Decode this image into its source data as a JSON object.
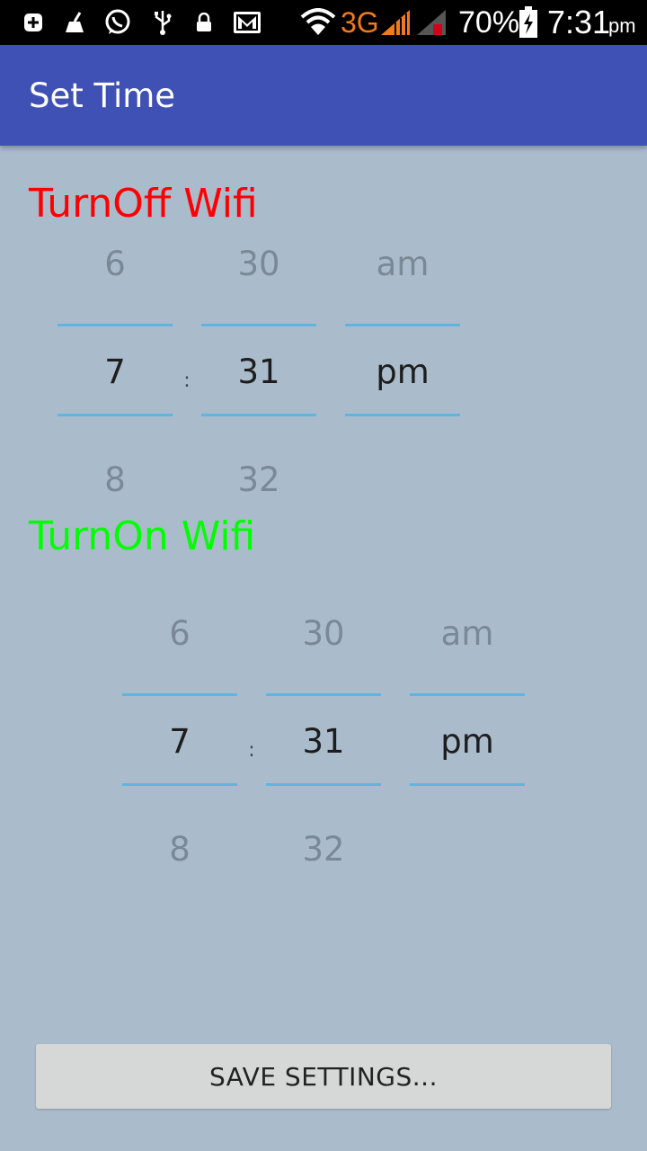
{
  "status_bar": {
    "network": "3G",
    "battery": "70%",
    "time": "7:31",
    "ampm": "pm",
    "icons": [
      "add-box-icon",
      "broom-icon",
      "whatsapp-icon",
      "usb-icon",
      "lock-icon",
      "gmail-icon",
      "wifi-icon",
      "signal-icon",
      "signal-secondary-icon",
      "battery-charging-icon"
    ]
  },
  "app_bar": {
    "title": "Set Time"
  },
  "turn_off": {
    "label": "TurnOff Wifi",
    "label_color": "#ff0000",
    "picker": {
      "hour": {
        "prev": "6",
        "current": "7",
        "next": "8"
      },
      "minute": {
        "prev": "30",
        "current": "31",
        "next": "32"
      },
      "period": {
        "prev": "am",
        "current": "pm",
        "next": ""
      },
      "separator": ":"
    }
  },
  "turn_on": {
    "label": "TurnOn Wifi",
    "label_color": "#00ff00",
    "picker": {
      "hour": {
        "prev": "6",
        "current": "7",
        "next": "8"
      },
      "minute": {
        "prev": "30",
        "current": "31",
        "next": "32"
      },
      "period": {
        "prev": "am",
        "current": "pm",
        "next": ""
      },
      "separator": ":"
    }
  },
  "save_button": {
    "label": "SAVE SETTINGS..."
  },
  "colors": {
    "app_bar": "#3f51b5",
    "background": "#aabbcc",
    "divider": "#5eb6e0",
    "network_orange": "#f07a1a"
  }
}
